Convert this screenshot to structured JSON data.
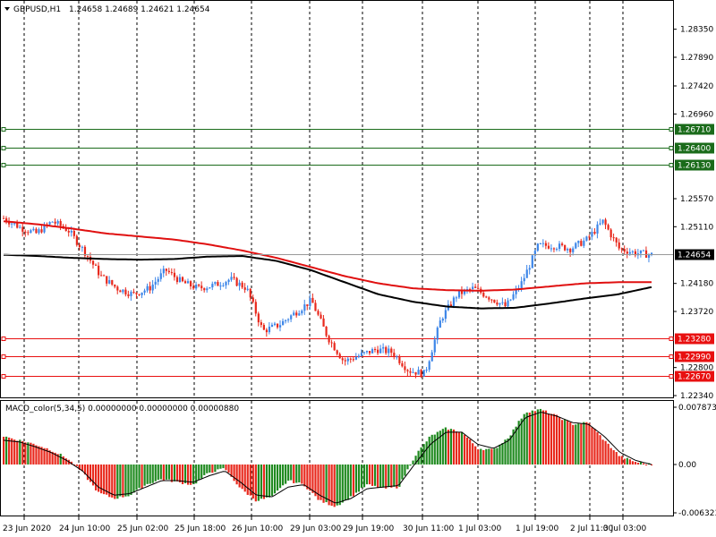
{
  "header": {
    "symbol": "GBPUSD,H1",
    "ohlc": "1.24658 1.24689 1.24621 1.24654"
  },
  "macd_header": {
    "label": "MACD_color(5,34,5) 0.00000000 0.00000000 0.00000880"
  },
  "price_axis": {
    "ticks": [
      "1.28350",
      "1.27890",
      "1.27420",
      "1.26960",
      "1.25570",
      "1.25110",
      "1.24180",
      "1.23720",
      "1.22800",
      "1.22340"
    ],
    "current_label": "1.24654"
  },
  "macd_axis": {
    "ticks": [
      "0.0078738",
      "0.00",
      "-0.006323"
    ]
  },
  "time_axis": {
    "labels": [
      "23 Jun 2020",
      "24 Jun 10:00",
      "25 Jun 02:00",
      "25 Jun 18:00",
      "26 Jun 10:00",
      "29 Jun 03:00",
      "29 Jun 19:00",
      "30 Jun 11:00",
      "1 Jul 03:00",
      "1 Jul 19:00",
      "2 Jul 11:00",
      "3 Jul 03:00"
    ]
  },
  "levels": [
    {
      "label": "1.26710",
      "color": "#1a6b1a"
    },
    {
      "label": "1.26400",
      "color": "#1a6b1a"
    },
    {
      "label": "1.26130",
      "color": "#1a6b1a"
    },
    {
      "label": "1.23280",
      "color": "#e81010"
    },
    {
      "label": "1.22990",
      "color": "#e81010"
    },
    {
      "label": "1.22670",
      "color": "#e81010"
    }
  ],
  "colors": {
    "bull_candle": "#3d86e8",
    "bear_candle": "#e8281c",
    "ma_fast": "#e01010",
    "ma_slow": "#000000",
    "macd_up": "#1f8a1f",
    "macd_down": "#e8281c",
    "macd_signal": "#000000",
    "grid": "#000000",
    "current_price": "#000000"
  },
  "chart_data": [
    {
      "type": "candlestick",
      "title": "GBPUSD,H1",
      "ohlc_last": [
        1.24658,
        1.24689,
        1.24621,
        1.24654
      ],
      "ylim": [
        1.2234,
        1.288
      ],
      "x": [
        "23 Jun 2020",
        "24 Jun 10:00",
        "25 Jun 02:00",
        "25 Jun 18:00",
        "26 Jun 10:00",
        "29 Jun 03:00",
        "29 Jun 19:00",
        "30 Jun 11:00",
        "1 Jul 03:00",
        "1 Jul 19:00",
        "2 Jul 11:00",
        "3 Jul 03:00"
      ],
      "close_path": [
        1.2525,
        1.251,
        1.25,
        1.252,
        1.2505,
        1.247,
        1.243,
        1.241,
        1.24,
        1.241,
        1.244,
        1.242,
        1.241,
        1.2415,
        1.2425,
        1.241,
        1.234,
        1.235,
        1.237,
        1.239,
        1.233,
        1.229,
        1.23,
        1.231,
        1.2305,
        1.2275,
        1.227,
        1.236,
        1.24,
        1.241,
        1.2395,
        1.238,
        1.242,
        1.248,
        1.248,
        1.2475,
        1.249,
        1.252,
        1.2475,
        1.2468,
        1.2465
      ],
      "series": [
        {
          "name": "",
          "kind": "moving_average",
          "color": "#e01010",
          "values": [
            1.252,
            1.2515,
            1.2508,
            1.25,
            1.2495,
            1.249,
            1.2482,
            1.2472,
            1.246,
            1.2445,
            1.243,
            1.2418,
            1.241,
            1.2407,
            1.2406,
            1.2408,
            1.2413,
            1.2418,
            1.242,
            1.242
          ]
        },
        {
          "name": "",
          "kind": "moving_average",
          "color": "#000000",
          "values": [
            1.2465,
            1.2463,
            1.246,
            1.2458,
            1.2457,
            1.2458,
            1.2462,
            1.2463,
            1.2455,
            1.244,
            1.242,
            1.24,
            1.2388,
            1.238,
            1.2377,
            1.2378,
            1.2385,
            1.2393,
            1.24,
            1.2412
          ]
        }
      ],
      "levels": [
        1.2671,
        1.264,
        1.2613,
        1.2328,
        1.2299,
        1.2267
      ],
      "current": 1.24654
    },
    {
      "type": "bar",
      "title": "MACD_color(5,34,5)",
      "ylim": [
        -0.006323,
        0.0078738
      ],
      "histogram_path": [
        0.0035,
        0.003,
        0.0025,
        0.0018,
        0.0008,
        -0.001,
        -0.0035,
        -0.0042,
        -0.0038,
        -0.0025,
        -0.0018,
        -0.0022,
        -0.0025,
        -0.001,
        -0.0005,
        -0.003,
        -0.0045,
        -0.004,
        -0.002,
        -0.0025,
        -0.0045,
        -0.0052,
        -0.004,
        -0.0025,
        -0.003,
        -0.0028,
        0.001,
        0.0035,
        0.0045,
        0.004,
        0.002,
        0.0018,
        0.0035,
        0.0065,
        0.0068,
        0.006,
        0.005,
        0.0052,
        0.003,
        0.001,
        0.0003,
        0.0
      ],
      "signal_path": [
        0.003,
        0.0028,
        0.0022,
        0.0015,
        0.0005,
        -0.0008,
        -0.0028,
        -0.0038,
        -0.0036,
        -0.0028,
        -0.002,
        -0.002,
        -0.0022,
        -0.0014,
        -0.0008,
        -0.0022,
        -0.0038,
        -0.004,
        -0.0028,
        -0.0025,
        -0.0038,
        -0.0048,
        -0.0042,
        -0.003,
        -0.0028,
        -0.0026,
        0.0,
        0.0025,
        0.004,
        0.004,
        0.0025,
        0.002,
        0.003,
        0.0058,
        0.0065,
        0.006,
        0.0052,
        0.005,
        0.0035,
        0.0015,
        0.0005,
        0.0
      ]
    }
  ]
}
